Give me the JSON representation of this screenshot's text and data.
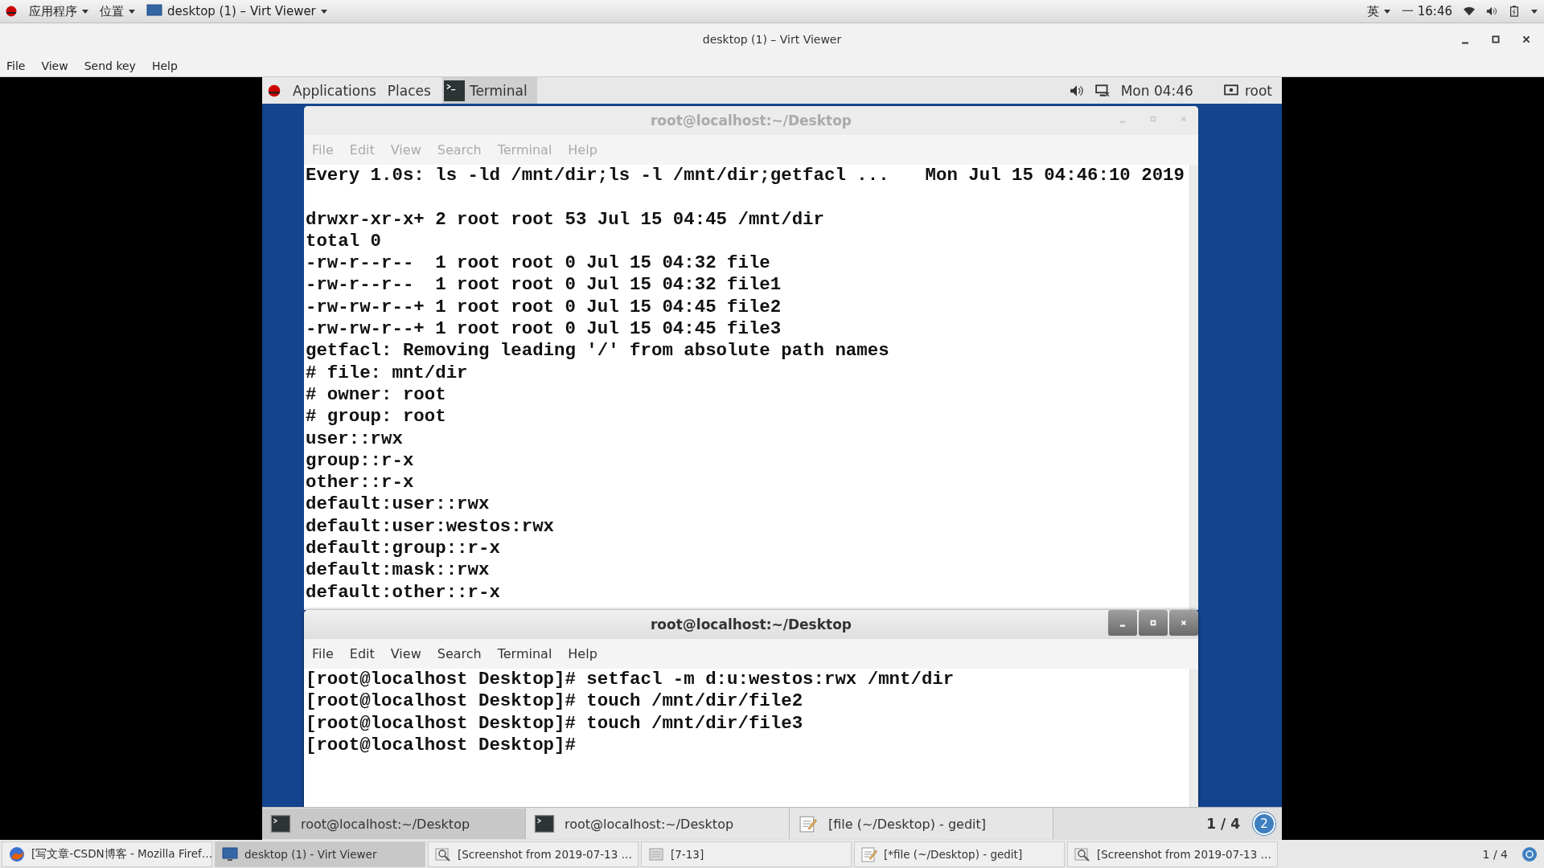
{
  "host_top_bar": {
    "menus": [
      {
        "label": "应用程序"
      },
      {
        "label": "位置"
      }
    ],
    "active_window": "desktop (1) – Virt Viewer",
    "input_method": "英",
    "clock": "一 16:46"
  },
  "window": {
    "title": "desktop (1) – Virt Viewer",
    "menu": [
      "File",
      "View",
      "Send key",
      "Help"
    ]
  },
  "guest_top_bar": {
    "menus": [
      "Applications",
      "Places"
    ],
    "active_app": "Terminal",
    "clock": "Mon 04:46",
    "user": "root"
  },
  "terminals": [
    {
      "title": "root@localhost:~/Desktop",
      "active": false,
      "menu": [
        "File",
        "Edit",
        "View",
        "Search",
        "Terminal",
        "Help"
      ],
      "header_command": "Every 1.0s: ls -ld /mnt/dir;ls -l /mnt/dir;getfacl ...",
      "header_time": "Mon Jul 15 04:46:10 2019",
      "lines": [
        "drwxr-xr-x+ 2 root root 53 Jul 15 04:45 /mnt/dir",
        "total 0",
        "-rw-r--r--  1 root root 0 Jul 15 04:32 file",
        "-rw-r--r--  1 root root 0 Jul 15 04:32 file1",
        "-rw-rw-r--+ 1 root root 0 Jul 15 04:45 file2",
        "-rw-rw-r--+ 1 root root 0 Jul 15 04:45 file3",
        "getfacl: Removing leading '/' from absolute path names",
        "# file: mnt/dir",
        "# owner: root",
        "# group: root",
        "user::rwx",
        "group::r-x",
        "other::r-x",
        "default:user::rwx",
        "default:user:westos:rwx",
        "default:group::r-x",
        "default:mask::rwx",
        "default:other::r-x"
      ]
    },
    {
      "title": "root@localhost:~/Desktop",
      "active": true,
      "menu": [
        "File",
        "Edit",
        "View",
        "Search",
        "Terminal",
        "Help"
      ],
      "lines": [
        "[root@localhost Desktop]# setfacl -m d:u:westos:rwx /mnt/dir",
        "[root@localhost Desktop]# touch /mnt/dir/file2",
        "[root@localhost Desktop]# touch /mnt/dir/file3",
        "[root@localhost Desktop]#"
      ]
    }
  ],
  "guest_taskbar": {
    "tasks": [
      {
        "label": "root@localhost:~/Desktop",
        "kind": "terminal",
        "selected": true
      },
      {
        "label": "root@localhost:~/Desktop",
        "kind": "terminal",
        "selected": false
      },
      {
        "label": "[file (~/Desktop) - gedit]",
        "kind": "editor",
        "selected": false
      }
    ],
    "workspace": "1 / 4",
    "notifications": "2"
  },
  "host_taskbar": {
    "tasks": [
      {
        "label": "[写文章-CSDN博客 - Mozilla Firef…",
        "kind": "browser",
        "selected": false
      },
      {
        "label": "desktop (1) - Virt Viewer",
        "kind": "viewer",
        "selected": true
      },
      {
        "label": "[Screenshot from 2019-07-13 …",
        "kind": "image",
        "selected": false
      },
      {
        "label": "[7-13]",
        "kind": "folder",
        "selected": false
      },
      {
        "label": "[*file (~/Desktop) - gedit]",
        "kind": "editor",
        "selected": false
      },
      {
        "label": "[Screenshot from 2019-07-13 …",
        "kind": "image",
        "selected": false
      }
    ],
    "workspace": "1 / 4"
  }
}
